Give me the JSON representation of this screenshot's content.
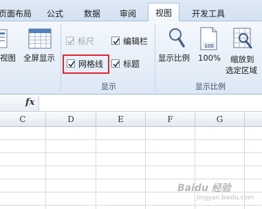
{
  "tabs": {
    "page_layout": "页面布局",
    "formulas": "公式",
    "data": "数据",
    "review": "审阅",
    "view": "视图",
    "developer": "开发工具"
  },
  "ribbon": {
    "views_group": {
      "page_view_label": "视图",
      "fullscreen_label": "全屏显示"
    },
    "show_group": {
      "ruler": "标尺",
      "formula_bar": "编辑栏",
      "gridlines": "网格线",
      "headings": "标题",
      "group_label": "显示"
    },
    "zoom_group": {
      "zoom_label": "显示比例",
      "zoom_100_label": "100%",
      "zoom_selection_line1": "缩放到",
      "zoom_selection_line2": "选定区域",
      "group_label": "显示比例"
    }
  },
  "formula_bar": {
    "fx": "fx"
  },
  "columns": [
    "C",
    "D",
    "E",
    "F",
    "G"
  ],
  "watermark": {
    "text": "Baidu 经验",
    "sub": "jingyan.baidu.com"
  },
  "colors": {
    "highlight": "#e0242a",
    "ribbon_bg": "#e6eef8",
    "accent": "#2b5797"
  }
}
